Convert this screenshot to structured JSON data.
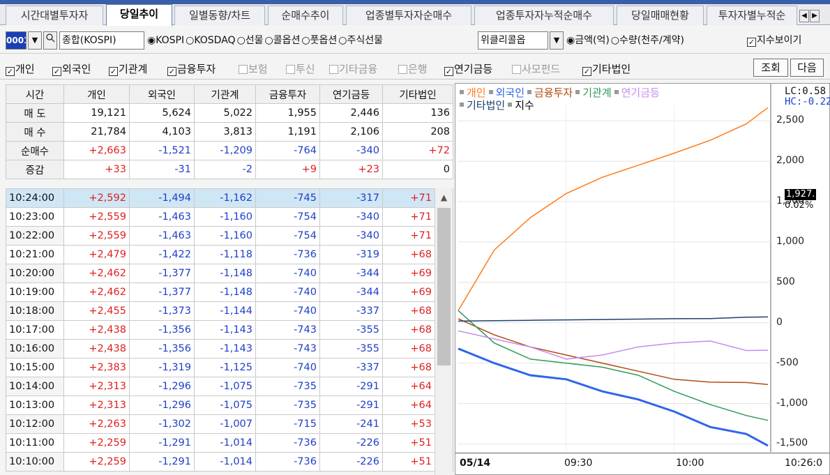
{
  "tabs": [
    "시간대별투자자",
    "당일추이",
    "일별동향/차트",
    "순매수추이",
    "업종별투자자순매수",
    "업종투자자누적순매수",
    "당일매매현황",
    "투자자별누적순"
  ],
  "active_tab": 1,
  "toolbar": {
    "code": "0001",
    "index_name": "종합(KOSPI)",
    "markets": [
      "KOSPI",
      "KOSDAQ",
      "선물",
      "콜옵션",
      "풋옵션",
      "주식선물"
    ],
    "market_selected": 0,
    "weekly_select": "위클리콜옵",
    "units": [
      "금액(억)",
      "수량(천주/계약)"
    ],
    "unit_selected": 0,
    "show_index_label": "지수보이기"
  },
  "filters": [
    {
      "label": "개인",
      "checked": true
    },
    {
      "label": "외국인",
      "checked": true
    },
    {
      "label": "기관계",
      "checked": true
    },
    {
      "label": "금융투자",
      "checked": true
    },
    {
      "label": "보험",
      "checked": false
    },
    {
      "label": "투신",
      "checked": false
    },
    {
      "label": "기타금융",
      "checked": false
    },
    {
      "label": "은행",
      "checked": false
    },
    {
      "label": "연기금등",
      "checked": true
    },
    {
      "label": "사모펀드",
      "checked": false
    },
    {
      "label": "기타법인",
      "checked": true
    }
  ],
  "buttons": {
    "query": "조회",
    "next": "다음"
  },
  "summary": {
    "headers": [
      "시간",
      "개인",
      "외국인",
      "기관계",
      "금융투자",
      "연기금등",
      "기타법인"
    ],
    "rows": [
      {
        "label": "매 도",
        "values": [
          "19,121",
          "5,624",
          "5,022",
          "1,955",
          "2,446",
          "136"
        ]
      },
      {
        "label": "매 수",
        "values": [
          "21,784",
          "4,103",
          "3,813",
          "1,191",
          "2,106",
          "208"
        ]
      },
      {
        "label": "순매수",
        "values": [
          "+2,663",
          "-1,521",
          "-1,209",
          "-764",
          "-340",
          "+72"
        ]
      },
      {
        "label": "증감",
        "values": [
          "+33",
          "-31",
          "-2",
          "+9",
          "+23",
          "0"
        ]
      }
    ]
  },
  "timeseries": [
    {
      "time": "10:24:00",
      "values": [
        "+2,592",
        "-1,494",
        "-1,162",
        "-745",
        "-317",
        "+71"
      ]
    },
    {
      "time": "10:23:00",
      "values": [
        "+2,559",
        "-1,463",
        "-1,160",
        "-754",
        "-340",
        "+71"
      ]
    },
    {
      "time": "10:22:00",
      "values": [
        "+2,559",
        "-1,463",
        "-1,160",
        "-754",
        "-340",
        "+71"
      ]
    },
    {
      "time": "10:21:00",
      "values": [
        "+2,479",
        "-1,422",
        "-1,118",
        "-736",
        "-319",
        "+68"
      ]
    },
    {
      "time": "10:20:00",
      "values": [
        "+2,462",
        "-1,377",
        "-1,148",
        "-740",
        "-344",
        "+69"
      ]
    },
    {
      "time": "10:19:00",
      "values": [
        "+2,462",
        "-1,377",
        "-1,148",
        "-740",
        "-344",
        "+69"
      ]
    },
    {
      "time": "10:18:00",
      "values": [
        "+2,455",
        "-1,373",
        "-1,144",
        "-740",
        "-337",
        "+68"
      ]
    },
    {
      "time": "10:17:00",
      "values": [
        "+2,438",
        "-1,356",
        "-1,143",
        "-743",
        "-355",
        "+68"
      ]
    },
    {
      "time": "10:16:00",
      "values": [
        "+2,438",
        "-1,356",
        "-1,143",
        "-743",
        "-355",
        "+68"
      ]
    },
    {
      "time": "10:15:00",
      "values": [
        "+2,383",
        "-1,319",
        "-1,125",
        "-740",
        "-337",
        "+68"
      ]
    },
    {
      "time": "10:14:00",
      "values": [
        "+2,313",
        "-1,296",
        "-1,075",
        "-735",
        "-291",
        "+64"
      ]
    },
    {
      "time": "10:13:00",
      "values": [
        "+2,313",
        "-1,296",
        "-1,075",
        "-735",
        "-291",
        "+64"
      ]
    },
    {
      "time": "10:12:00",
      "values": [
        "+2,263",
        "-1,302",
        "-1,007",
        "-715",
        "-241",
        "+53"
      ]
    },
    {
      "time": "10:11:00",
      "values": [
        "+2,259",
        "-1,291",
        "-1,014",
        "-736",
        "-226",
        "+51"
      ]
    },
    {
      "time": "10:10:00",
      "values": [
        "+2,259",
        "-1,291",
        "-1,014",
        "-736",
        "-226",
        "+51"
      ]
    }
  ],
  "chart": {
    "legend": [
      {
        "name": "개인",
        "color": "#ff7a1a"
      },
      {
        "name": "외국인",
        "color": "#2f66e8"
      },
      {
        "name": "금융투자",
        "color": "#b04a12"
      },
      {
        "name": "기관계",
        "color": "#2d9a5a"
      },
      {
        "name": "연기금등",
        "color": "#c58cf0"
      },
      {
        "name": "기타법인",
        "color": "#1f3f6e"
      },
      {
        "name": "지수",
        "color": "#000000"
      }
    ],
    "lc": "LC:0.58",
    "hc": "HC:-0.22",
    "y_ticks": [
      "2,500",
      "2,000",
      "1,500",
      "1,000",
      "500",
      "0",
      "-500",
      "-1,000",
      "-1,500"
    ],
    "price": "1,927.",
    "price_pct": "0.02%",
    "date": "05/14",
    "x_labels": [
      "09:30",
      "10:00",
      "10:26:0"
    ]
  },
  "chart_data": {
    "type": "line",
    "x_range": [
      "09:00",
      "10:26"
    ],
    "ylim": [
      -1600,
      2700
    ],
    "y_ticks": [
      2500,
      2000,
      1500,
      1000,
      500,
      0,
      -500,
      -1000,
      -1500
    ],
    "series": [
      {
        "name": "개인",
        "color": "#ff7a1a",
        "x": [
          "09:00",
          "09:10",
          "09:20",
          "09:30",
          "09:40",
          "09:50",
          "10:00",
          "10:10",
          "10:20",
          "10:26"
        ],
        "values": [
          150,
          900,
          1300,
          1600,
          1800,
          1950,
          2100,
          2259,
          2462,
          2663
        ]
      },
      {
        "name": "외국인",
        "color": "#2f66e8",
        "x": [
          "09:00",
          "09:10",
          "09:20",
          "09:30",
          "09:40",
          "09:50",
          "10:00",
          "10:10",
          "10:20",
          "10:26"
        ],
        "values": [
          -320,
          -500,
          -650,
          -700,
          -850,
          -950,
          -1100,
          -1291,
          -1377,
          -1521
        ]
      },
      {
        "name": "금융투자",
        "color": "#b04a12",
        "x": [
          "09:00",
          "09:10",
          "09:20",
          "09:30",
          "09:40",
          "09:50",
          "10:00",
          "10:10",
          "10:20",
          "10:26"
        ],
        "values": [
          50,
          -150,
          -300,
          -400,
          -500,
          -600,
          -700,
          -736,
          -740,
          -764
        ]
      },
      {
        "name": "기관계",
        "color": "#2d9a5a",
        "x": [
          "09:00",
          "09:10",
          "09:20",
          "09:30",
          "09:40",
          "09:50",
          "10:00",
          "10:10",
          "10:20",
          "10:26"
        ],
        "values": [
          150,
          -250,
          -450,
          -500,
          -550,
          -650,
          -850,
          -1014,
          -1148,
          -1209
        ]
      },
      {
        "name": "연기금등",
        "color": "#c58cf0",
        "x": [
          "09:00",
          "09:10",
          "09:20",
          "09:30",
          "09:40",
          "09:50",
          "10:00",
          "10:10",
          "10:20",
          "10:26"
        ],
        "values": [
          -100,
          -200,
          -300,
          -450,
          -400,
          -300,
          -250,
          -226,
          -344,
          -340
        ]
      },
      {
        "name": "기타법인",
        "color": "#1f3f6e",
        "x": [
          "09:00",
          "09:10",
          "09:20",
          "09:30",
          "09:40",
          "09:50",
          "10:00",
          "10:10",
          "10:20",
          "10:26"
        ],
        "values": [
          20,
          25,
          30,
          35,
          40,
          45,
          50,
          51,
          69,
          72
        ]
      }
    ]
  }
}
